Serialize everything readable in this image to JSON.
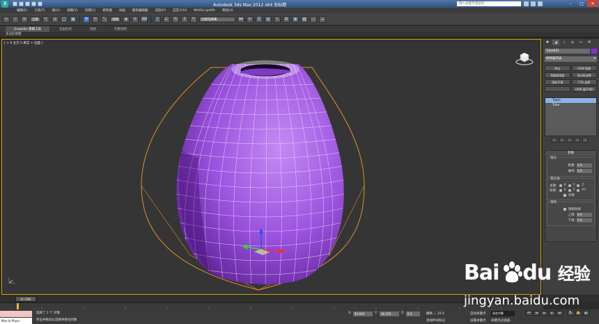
{
  "window": {
    "title": "Autodesk 3ds Max  2012 x64      无标题",
    "help_search_placeholder": "键入关键字或短语",
    "min": "–",
    "max": "□",
    "close": "✕"
  },
  "menu": [
    "编辑(E)",
    "工具(T)",
    "组(G)",
    "视图(V)",
    "创建(C)",
    "修改器",
    "动画",
    "图形编辑器",
    "渲染(R)",
    "自定义(U)",
    "MAXScript(M)",
    "帮助(H)"
  ],
  "toolbar": {
    "selection_filter": "全部",
    "coord_system": "视图",
    "named_selection": "创建选择集"
  },
  "ribbon": {
    "tabs": [
      "Graphite 建模工具",
      "自由形式",
      "选择",
      "对象绘制"
    ],
    "selected": 0,
    "sub_label": "多边形建模"
  },
  "viewport": {
    "label": "[ + 0 主交 0 真实 + 边面 ]"
  },
  "command_panel": {
    "object_name": "Tube001",
    "object_color": "#8a2be2",
    "modifier_list": "修改器列表",
    "buttons": [
      "挤出",
      "UVW 贴图",
      "弯曲修改器",
      "多边形选择",
      "涡轮平滑",
      "FFD 选择",
      "",
      "UVW 展开(保)"
    ],
    "stack": [
      "Taper",
      "Tube"
    ],
    "parameters_title": "参数",
    "taper_group_title": "锥化:",
    "amount_label": "数量:",
    "amount_value": "0.5",
    "curve_label": "曲线:",
    "curve_value": "0.0",
    "axis_group_title": "锥化轴:",
    "primary_label": "主轴:",
    "primary_options": [
      "X",
      "Y",
      "Z"
    ],
    "effect_label": "效果:",
    "effect_options": [
      "X",
      "Y",
      "XY"
    ],
    "symmetry_label": "对称",
    "limit_group_title": "限制",
    "limit_effect_label": "限制效果",
    "upper_label": "上限:",
    "upper_value": "0.0",
    "lower_label": "下限:",
    "lower_value": "0.0"
  },
  "timeline": {
    "slider": "0 / 100"
  },
  "status": {
    "maxscript_label": "Max to Physc",
    "selected_text": "选择了 1 个 对象",
    "prompt_text": "单击并拖动以选择并移动对象",
    "x_value": "83.939",
    "y_value": "36.379",
    "z_value": "0.0",
    "grid_text": "栅格 = 10.0",
    "add_time_tag": "添加时间标记",
    "auto_key": "自动关键点",
    "selected_option": "选定对象",
    "set_key": "设置关键点",
    "key_filters": "关键点过滤器..."
  },
  "watermark": {
    "logo": "Bai",
    "logo2": "du",
    "logo_cn": "经验",
    "url": "jingyan.baidu.com"
  }
}
